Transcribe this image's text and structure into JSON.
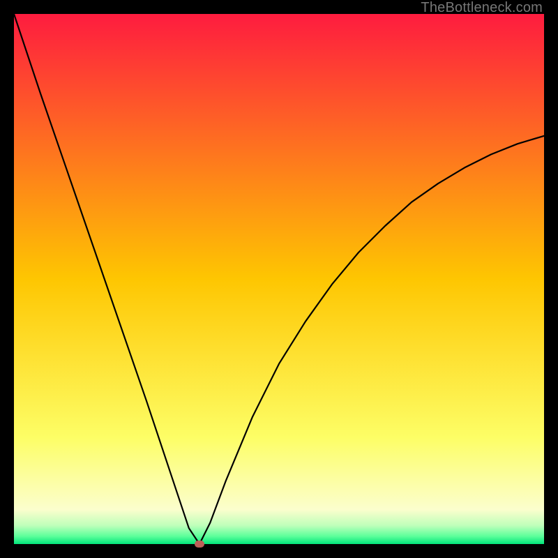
{
  "watermark": "TheBottleneck.com",
  "chart_data": {
    "type": "line",
    "title": "",
    "xlabel": "",
    "ylabel": "",
    "xlim": [
      0,
      100
    ],
    "ylim": [
      0,
      100
    ],
    "grid": false,
    "series": [
      {
        "name": "bottleneck-curve",
        "x": [
          0,
          5,
          10,
          15,
          20,
          25,
          30,
          33,
          35,
          37,
          40,
          45,
          50,
          55,
          60,
          65,
          70,
          75,
          80,
          85,
          90,
          95,
          100
        ],
        "y": [
          100,
          85,
          70.5,
          56,
          41.5,
          27,
          12,
          3,
          0,
          4,
          12,
          24,
          34,
          42,
          49,
          55,
          60,
          64.5,
          68,
          71,
          73.5,
          75.5,
          77
        ]
      }
    ],
    "marker": {
      "x": 35,
      "y": 0,
      "color": "#bd6059"
    },
    "background_gradient_stops": [
      {
        "pos": 0.0,
        "color": "#fe1c3f"
      },
      {
        "pos": 0.5,
        "color": "#fec601"
      },
      {
        "pos": 0.8,
        "color": "#fdfe66"
      },
      {
        "pos": 0.935,
        "color": "#fbfecd"
      },
      {
        "pos": 0.965,
        "color": "#bfffba"
      },
      {
        "pos": 0.985,
        "color": "#5dff9b"
      },
      {
        "pos": 1.0,
        "color": "#01e47a"
      }
    ]
  }
}
